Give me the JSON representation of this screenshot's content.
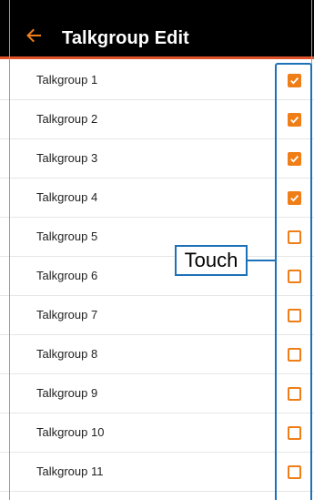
{
  "app_bar": {
    "title": "Talkgroup Edit",
    "back_icon": "arrow-left-icon",
    "accent_color": "#f07e16",
    "background_color": "#000000"
  },
  "talkgroups": [
    {
      "label": "Talkgroup 1",
      "checked": true
    },
    {
      "label": "Talkgroup 2",
      "checked": true
    },
    {
      "label": "Talkgroup 3",
      "checked": true
    },
    {
      "label": "Talkgroup 4",
      "checked": true
    },
    {
      "label": "Talkgroup 5",
      "checked": false
    },
    {
      "label": "Talkgroup 6",
      "checked": false
    },
    {
      "label": "Talkgroup 7",
      "checked": false
    },
    {
      "label": "Talkgroup 8",
      "checked": false
    },
    {
      "label": "Talkgroup 9",
      "checked": false
    },
    {
      "label": "Talkgroup 10",
      "checked": false
    },
    {
      "label": "Talkgroup 11",
      "checked": false
    }
  ],
  "annotation": {
    "label": "Touch",
    "color": "#1d71b8"
  },
  "checkbox_color": "#f07e16"
}
